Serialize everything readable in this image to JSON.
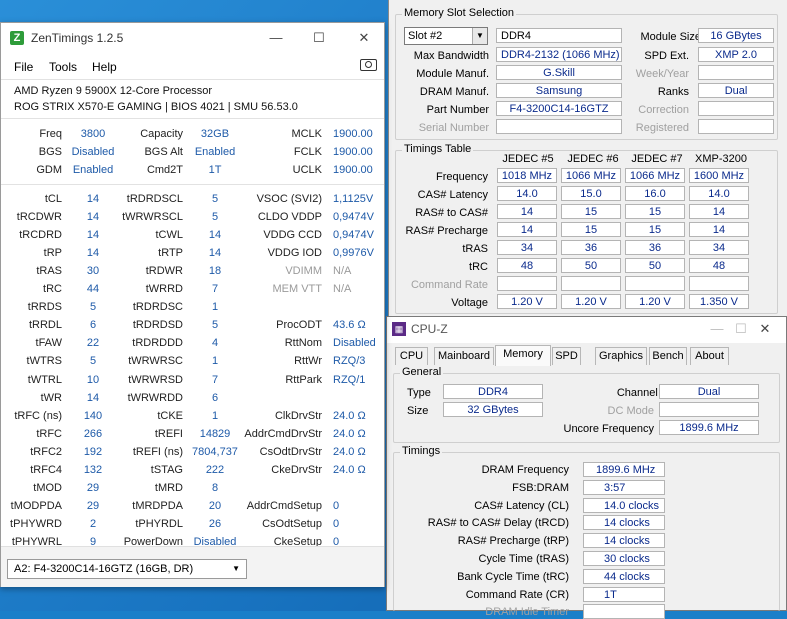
{
  "zen": {
    "title": "ZenTimings 1.2.5",
    "menu": [
      "File",
      "Tools",
      "Help"
    ],
    "cpu": "AMD Ryzen 9 5900X 12-Core Processor",
    "board": "ROG STRIX X570-E GAMING | BIOS 4021 | SMU 56.53.0",
    "top_rows": [
      [
        "Freq",
        "3800",
        "Capacity",
        "32GB",
        "MCLK",
        "1900.00"
      ],
      [
        "BGS",
        "Disabled",
        "BGS Alt",
        "Enabled",
        "FCLK",
        "1900.00"
      ],
      [
        "GDM",
        "Enabled",
        "Cmd2T",
        "1T",
        "UCLK",
        "1900.00"
      ]
    ],
    "timing_rows": [
      [
        "tCL",
        "14",
        "tRDRDSCL",
        "5",
        "VSOC (SVI2)",
        "1,1125V"
      ],
      [
        "tRCDWR",
        "14",
        "tWRWRSCL",
        "5",
        "CLDO VDDP",
        "0,9474V"
      ],
      [
        "tRCDRD",
        "14",
        "tCWL",
        "14",
        "VDDG CCD",
        "0,9474V"
      ],
      [
        "tRP",
        "14",
        "tRTP",
        "14",
        "VDDG IOD",
        "0,9976V"
      ],
      [
        "tRAS",
        "30",
        "tRDWR",
        "18",
        "VDIMM",
        "N/A"
      ],
      [
        "tRC",
        "44",
        "tWRRD",
        "7",
        "MEM VTT",
        "N/A"
      ],
      [
        "tRRDS",
        "5",
        "tRDRDSC",
        "1",
        "",
        ""
      ],
      [
        "tRRDL",
        "6",
        "tRDRDSD",
        "5",
        "ProcODT",
        "43.6 Ω"
      ],
      [
        "tFAW",
        "22",
        "tRDRDDD",
        "4",
        "RttNom",
        "Disabled"
      ],
      [
        "tWTRS",
        "5",
        "tWRWRSC",
        "1",
        "RttWr",
        "RZQ/3"
      ],
      [
        "tWTRL",
        "10",
        "tWRWRSD",
        "7",
        "RttPark",
        "RZQ/1"
      ],
      [
        "tWR",
        "14",
        "tWRWRDD",
        "6",
        "",
        ""
      ],
      [
        "tRFC (ns)",
        "140",
        "tCKE",
        "1",
        "ClkDrvStr",
        "24.0 Ω"
      ],
      [
        "tRFC",
        "266",
        "tREFI",
        "14829",
        "AddrCmdDrvStr",
        "24.0 Ω"
      ],
      [
        "tRFC2",
        "192",
        "tREFI (ns)",
        "7804,737",
        "CsOdtDrvStr",
        "24.0 Ω"
      ],
      [
        "tRFC4",
        "132",
        "tSTAG",
        "222",
        "CkeDrvStr",
        "24.0 Ω"
      ],
      [
        "tMOD",
        "29",
        "tMRD",
        "8",
        "",
        ""
      ],
      [
        "tMODPDA",
        "29",
        "tMRDPDA",
        "20",
        "AddrCmdSetup",
        "0"
      ],
      [
        "tPHYWRD",
        "2",
        "tPHYRDL",
        "26",
        "CsOdtSetup",
        "0"
      ],
      [
        "tPHYWRL",
        "9",
        "PowerDown",
        "Disabled",
        "CkeSetup",
        "0"
      ]
    ],
    "dimm_select": "A2: F4-3200C14-16GTZ (16GB, DR)"
  },
  "spd": {
    "slot_group_title": "Memory Slot Selection",
    "slot": "Slot #2",
    "type": "DDR4",
    "module_size_label": "Module Size",
    "module_size": "16 GBytes",
    "max_bw_label": "Max Bandwidth",
    "max_bw": "DDR4-2132 (1066 MHz)",
    "spd_ext_label": "SPD Ext.",
    "spd_ext": "XMP 2.0",
    "manuf_label": "Module Manuf.",
    "manuf": "G.Skill",
    "week_label": "Week/Year",
    "dram_manuf_label": "DRAM Manuf.",
    "dram_manuf": "Samsung",
    "ranks_label": "Ranks",
    "ranks": "Dual",
    "part_label": "Part Number",
    "part": "F4-3200C14-16GTZ",
    "correction_label": "Correction",
    "serial_label": "Serial Number",
    "registered_label": "Registered",
    "timings_title": "Timings Table",
    "columns": [
      "JEDEC #5",
      "JEDEC #6",
      "JEDEC #7",
      "XMP-3200"
    ],
    "rows": [
      {
        "label": "Frequency",
        "values": [
          "1018 MHz",
          "1066 MHz",
          "1066 MHz",
          "1600 MHz"
        ]
      },
      {
        "label": "CAS# Latency",
        "values": [
          "14.0",
          "15.0",
          "16.0",
          "14.0"
        ]
      },
      {
        "label": "RAS# to CAS#",
        "values": [
          "14",
          "15",
          "15",
          "14"
        ]
      },
      {
        "label": "RAS# Precharge",
        "values": [
          "14",
          "15",
          "15",
          "14"
        ]
      },
      {
        "label": "tRAS",
        "values": [
          "34",
          "36",
          "36",
          "34"
        ]
      },
      {
        "label": "tRC",
        "values": [
          "48",
          "50",
          "50",
          "48"
        ]
      },
      {
        "label": "Command Rate",
        "values": [
          "",
          "",
          "",
          ""
        ]
      },
      {
        "label": "Voltage",
        "values": [
          "1.20 V",
          "1.20 V",
          "1.20 V",
          "1.350 V"
        ]
      }
    ]
  },
  "mem": {
    "title": "CPU-Z",
    "tabs": [
      "CPU",
      "Mainboard",
      "Memory",
      "SPD",
      "Graphics",
      "Bench",
      "About"
    ],
    "general_title": "General",
    "type_label": "Type",
    "type": "DDR4",
    "size_label": "Size",
    "size": "32 GBytes",
    "channel_label": "Channel #",
    "channel": "Dual",
    "dc_label": "DC Mode",
    "uncore_label": "Uncore Frequency",
    "uncore": "1899.6 MHz",
    "timings_title": "Timings",
    "timings": [
      {
        "label": "DRAM Frequency",
        "value": "1899.6 MHz"
      },
      {
        "label": "FSB:DRAM",
        "value": "3:57"
      },
      {
        "label": "CAS# Latency (CL)",
        "value": "14.0 clocks"
      },
      {
        "label": "RAS# to CAS# Delay (tRCD)",
        "value": "14 clocks"
      },
      {
        "label": "RAS# Precharge (tRP)",
        "value": "14 clocks"
      },
      {
        "label": "Cycle Time (tRAS)",
        "value": "30 clocks"
      },
      {
        "label": "Bank Cycle Time (tRC)",
        "value": "44 clocks"
      },
      {
        "label": "Command Rate (CR)",
        "value": "1T"
      },
      {
        "label": "DRAM Idle Timer",
        "value": ""
      }
    ]
  }
}
